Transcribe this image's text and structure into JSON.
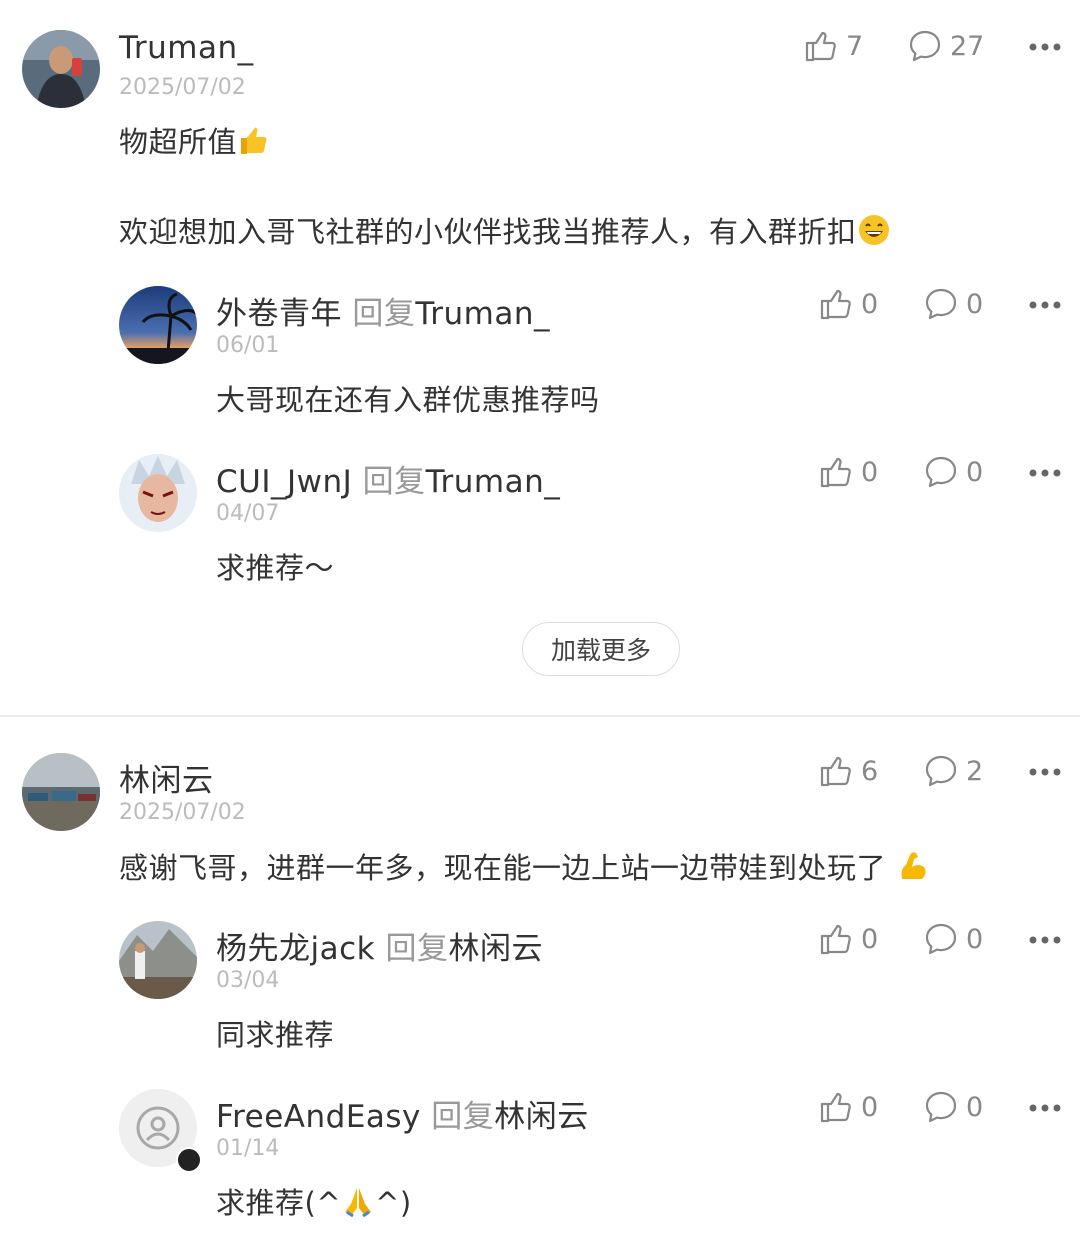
{
  "reply_word": "回复",
  "load_more": "加载更多",
  "comments": [
    {
      "user": "Truman_",
      "date": "2025/07/02",
      "likes": "7",
      "replies": "27",
      "line1": "物超所值",
      "line2": "欢迎想加入哥飞社群的小伙伴找我当推荐人，有入群折扣",
      "sub": [
        {
          "user": "外卷青年",
          "to": "Truman_",
          "date": "06/01",
          "likes": "0",
          "replies": "0",
          "text": "大哥现在还有入群优惠推荐吗"
        },
        {
          "user": "CUI_JwnJ",
          "to": "Truman_",
          "date": "04/07",
          "likes": "0",
          "replies": "0",
          "text": "求推荐～"
        }
      ]
    },
    {
      "user": "林闲云",
      "date": "2025/07/02",
      "likes": "6",
      "replies": "2",
      "line1": "感谢飞哥，进群一年多，现在能一边上站一边带娃到处玩了",
      "sub": [
        {
          "user": "杨先龙jack",
          "to": "林闲云",
          "date": "03/04",
          "likes": "0",
          "replies": "0",
          "text": "同求推荐"
        },
        {
          "user": "FreeAndEasy",
          "to": "林闲云",
          "date": "01/14",
          "likes": "0",
          "replies": "0",
          "text_before": "求推荐(^",
          "text_after": "^)"
        }
      ]
    }
  ],
  "icons": {
    "like": "thumbs-up-icon",
    "reply": "speech-bubble-icon",
    "more": "ellipsis-icon",
    "thumbs_emoji": "thumbs-up-emoji",
    "smile_emoji": "grinning-face-emoji",
    "muscle_emoji": "flexed-biceps-emoji",
    "pray_emoji": "folded-hands-emoji",
    "default_avatar": "user-placeholder-icon"
  },
  "colors": {
    "text": "#333333",
    "muted": "#999999",
    "date": "#bbbbbb",
    "emoji": "#f5b400"
  }
}
